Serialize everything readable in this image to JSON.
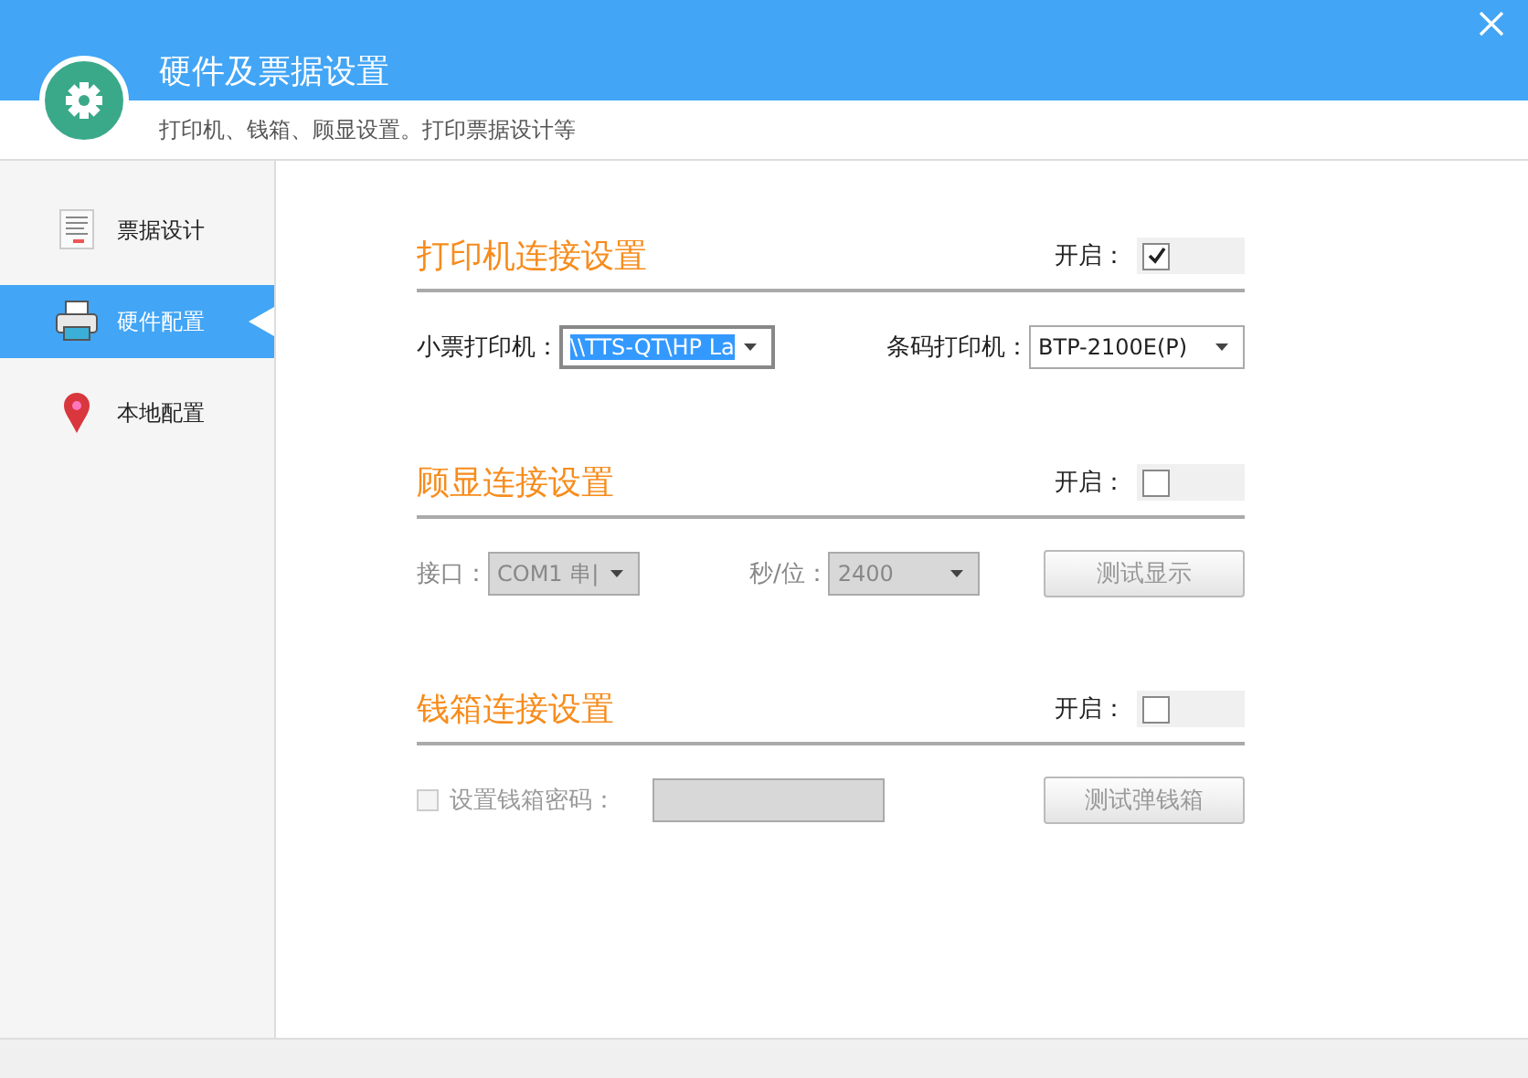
{
  "header": {
    "title": "硬件及票据设置",
    "subtitle": "打印机、钱箱、顾显设置。打印票据设计等"
  },
  "sidebar": {
    "items": [
      {
        "label": "票据设计",
        "selected": false
      },
      {
        "label": "硬件配置",
        "selected": true
      },
      {
        "label": "本地配置",
        "selected": false
      }
    ]
  },
  "sections": [
    {
      "title": "打印机连接设置",
      "enable_label": "开启：",
      "enabled": true,
      "fields": [
        {
          "kind": "select",
          "label": "小票打印机：",
          "value": "\\\\TTS-QT\\HP La",
          "focused": true,
          "disabled": false
        },
        {
          "kind": "select",
          "label": "条码打印机：",
          "value": "BTP-2100E(P)",
          "focused": false,
          "disabled": false
        }
      ]
    },
    {
      "title": "顾显连接设置",
      "enable_label": "开启：",
      "enabled": false,
      "fields": [
        {
          "kind": "select",
          "label": "接口：",
          "value": "COM1 串|",
          "focused": false,
          "disabled": true
        },
        {
          "kind": "select",
          "label": "秒/位：",
          "value": "2400",
          "focused": false,
          "disabled": true
        },
        {
          "kind": "button",
          "label": "测试显示",
          "disabled": true
        }
      ]
    },
    {
      "title": "钱箱连接设置",
      "enable_label": "开启：",
      "enabled": false,
      "fields": [
        {
          "kind": "checkbox",
          "label": "设置钱箱密码：",
          "checked": false,
          "disabled": true
        },
        {
          "kind": "input",
          "disabled": true
        },
        {
          "kind": "button",
          "label": "测试弹钱箱",
          "disabled": true
        }
      ]
    }
  ]
}
